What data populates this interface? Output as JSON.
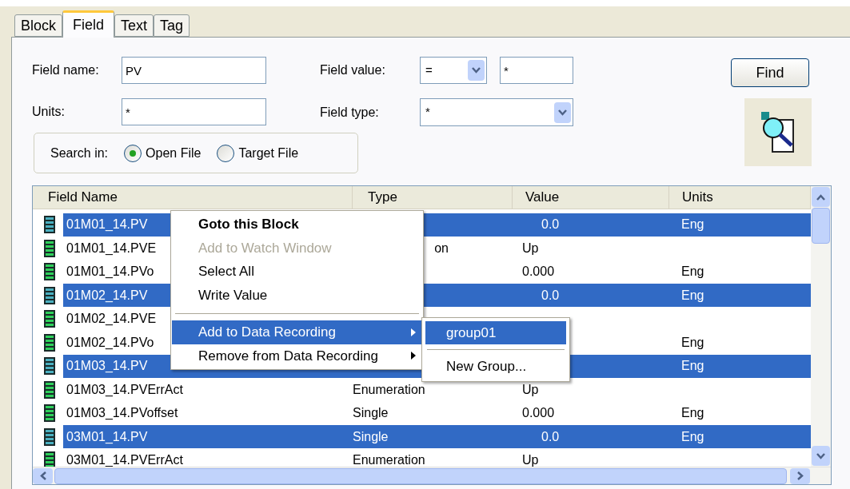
{
  "tabs": [
    {
      "label": "Block",
      "selected": false
    },
    {
      "label": "Field",
      "selected": true
    },
    {
      "label": "Text",
      "selected": false
    },
    {
      "label": "Tag",
      "selected": false
    }
  ],
  "form": {
    "field_name": {
      "label": "Field name:",
      "value": "PV"
    },
    "units": {
      "label": "Units:",
      "value": "*"
    },
    "field_value": {
      "label": "Field value:",
      "operator": "=",
      "value": "*"
    },
    "field_type": {
      "label": "Field type:",
      "value": "*"
    },
    "find_button": "Find"
  },
  "search_in": {
    "label": "Search in:",
    "options": [
      {
        "label": "Open File",
        "selected": true
      },
      {
        "label": "Target File",
        "selected": false
      }
    ]
  },
  "table": {
    "columns": [
      "Field Name",
      "Type",
      "Value",
      "Units"
    ],
    "rows": [
      {
        "name": "01M01_14.PV",
        "type": "",
        "value": "0.0",
        "units": "Eng",
        "selected": true
      },
      {
        "name": "01M01_14.PVE",
        "type": "on",
        "type_cut": true,
        "value": "Up",
        "units": "",
        "selected": false
      },
      {
        "name": "01M01_14.PVo",
        "type": "",
        "value": "0.000",
        "units": "Eng",
        "selected": false
      },
      {
        "name": "01M02_14.PV",
        "type": "",
        "value": "0.0",
        "units": "Eng",
        "selected": true
      },
      {
        "name": "01M02_14.PVE",
        "type": "",
        "value": "",
        "units": "",
        "selected": false
      },
      {
        "name": "01M02_14.PVo",
        "type": "",
        "value": "",
        "units": "Eng",
        "selected": false
      },
      {
        "name": "01M03_14.PV",
        "type": "",
        "value": "",
        "units": "Eng",
        "selected": true
      },
      {
        "name": "01M03_14.PVErrAct",
        "type": "Enumeration",
        "value": "Up",
        "units": "",
        "selected": false
      },
      {
        "name": "01M03_14.PVoffset",
        "type": "Single",
        "value": "0.000",
        "units": "Eng",
        "selected": false
      },
      {
        "name": "03M01_14.PV",
        "type": "Single",
        "value": "0.0",
        "units": "Eng",
        "selected": true
      },
      {
        "name": "03M01_14.PVErrAct",
        "type": "Enumeration",
        "value": "Up",
        "units": "",
        "selected": false
      }
    ]
  },
  "context_menu": {
    "items": [
      {
        "kind": "item",
        "label": "Goto this Block",
        "bold": true,
        "disabled": false,
        "highlighted": false,
        "submenu": false
      },
      {
        "kind": "item",
        "label": "Add to Watch Window",
        "bold": false,
        "disabled": true,
        "highlighted": false,
        "submenu": false
      },
      {
        "kind": "item",
        "label": "Select All",
        "bold": false,
        "disabled": false,
        "highlighted": false,
        "submenu": false
      },
      {
        "kind": "item",
        "label": "Write Value",
        "bold": false,
        "disabled": false,
        "highlighted": false,
        "submenu": false
      },
      {
        "kind": "separator"
      },
      {
        "kind": "item",
        "label": "Add to Data Recording",
        "bold": false,
        "disabled": false,
        "highlighted": true,
        "submenu": true
      },
      {
        "kind": "item",
        "label": "Remove from Data Recording",
        "bold": false,
        "disabled": false,
        "highlighted": false,
        "submenu": true
      }
    ]
  },
  "submenu": {
    "items": [
      {
        "kind": "item",
        "label": "group01",
        "highlighted": true
      },
      {
        "kind": "separator"
      },
      {
        "kind": "item",
        "label": "New Group...",
        "highlighted": false
      }
    ]
  }
}
